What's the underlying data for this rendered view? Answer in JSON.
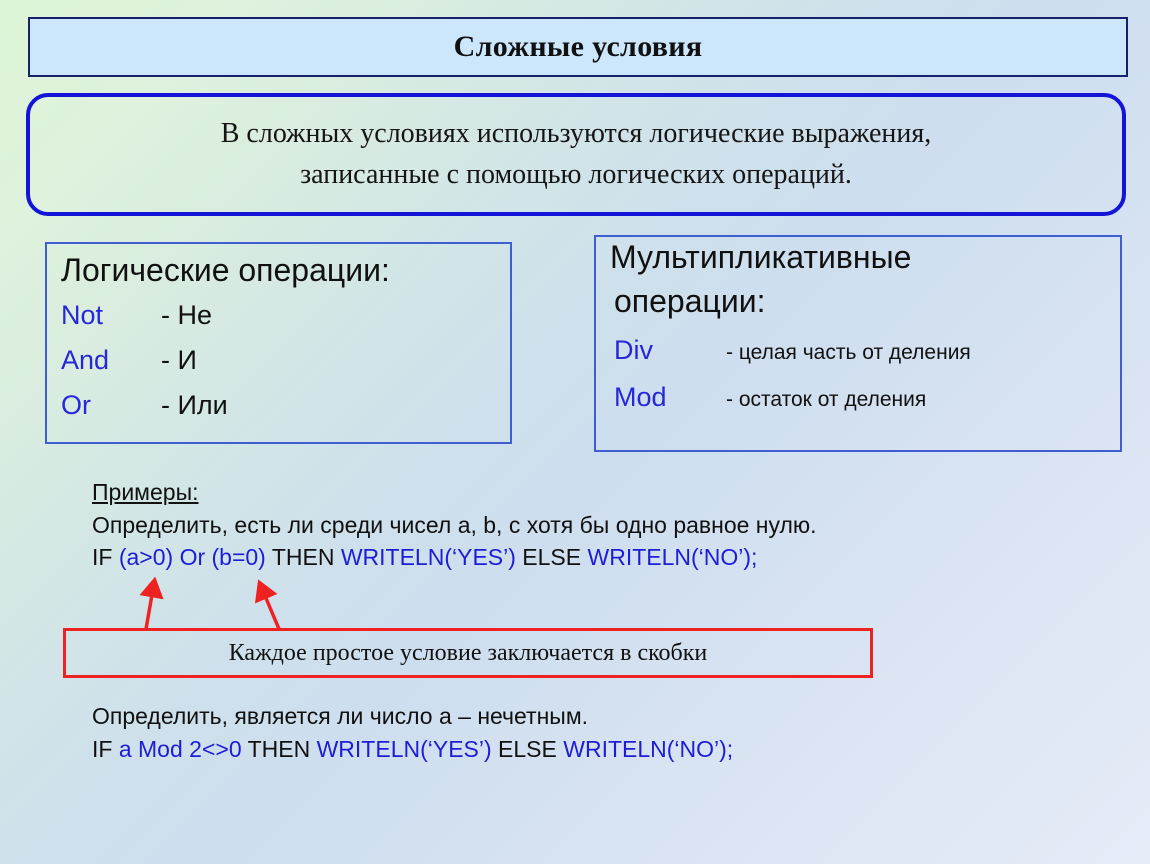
{
  "slide": {
    "title": "Сложные условия",
    "intro_lines": [
      "В сложных условиях используются логические выражения,",
      "записанные с помощью логических операций."
    ]
  },
  "logic_box": {
    "heading": "Логические операции:",
    "rows": [
      {
        "key": "Not",
        "value": "- Не"
      },
      {
        "key": "And",
        "value": "- И"
      },
      {
        "key": "Or",
        "value": "- Или"
      }
    ]
  },
  "mult_box": {
    "heading_line1": "Мультипликативные",
    "heading_line2": "операции:",
    "rows": [
      {
        "key": "Div",
        "value": "- целая часть от деления"
      },
      {
        "key": "Mod",
        "value": "- остаток от деления"
      }
    ]
  },
  "examples": {
    "label": "Примеры:",
    "example1": {
      "task": "Определить, есть ли среди чисел a, b, c хотя бы одно равное нулю.",
      "code": {
        "if_kw": "IF ",
        "condition": "(a>0) Or (b=0)",
        "then_kw": " THEN ",
        "then_call": "WRITELN(‘YES’)",
        "else_kw": " ELSE ",
        "else_call": "WRITELN(‘NO’);"
      }
    },
    "example2": {
      "task": "Определить, является ли число a – нечетным.",
      "code": {
        "if_kw": " IF ",
        "condition": "a Mod 2<>0",
        "then_kw": " THEN ",
        "then_call": "WRITELN(‘YES’)",
        "else_kw": " ELSE ",
        "else_call": "WRITELN(‘NO’);"
      }
    }
  },
  "callout": {
    "text": "Каждое простое условие заключается в скобки"
  },
  "colors": {
    "title_fill": "#cce6fb",
    "title_border": "#15216b",
    "intro_border": "#1414d8",
    "box_border": "#3f5fd0",
    "keyword_blue": "#2727d8",
    "code_blue": "#1d1dd8",
    "callout_red": "#ef2222",
    "text_black": "#111111"
  }
}
